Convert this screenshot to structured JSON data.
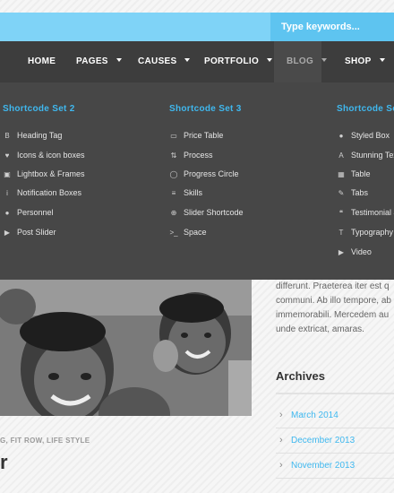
{
  "search": {
    "placeholder": "Type keywords..."
  },
  "nav": {
    "items": [
      {
        "label": "HOME"
      },
      {
        "label": "PAGES"
      },
      {
        "label": "CAUSES"
      },
      {
        "label": "PORTFOLIO"
      },
      {
        "label": "BLOG"
      },
      {
        "label": "SHOP"
      }
    ]
  },
  "mega": {
    "columns": [
      {
        "title": "Shortcode Set 2",
        "items": [
          {
            "label": "Heading Tag",
            "icon": "bold-icon"
          },
          {
            "label": "Icons & icon boxes",
            "icon": "heart-icon"
          },
          {
            "label": "Lightbox & Frames",
            "icon": "image-icon"
          },
          {
            "label": "Notification Boxes",
            "icon": "info-icon"
          },
          {
            "label": "Personnel",
            "icon": "user-icon"
          },
          {
            "label": "Post Slider",
            "icon": "play-icon"
          }
        ]
      },
      {
        "title": "Shortcode Set 3",
        "items": [
          {
            "label": "Price Table",
            "icon": "money-icon"
          },
          {
            "label": "Process",
            "icon": "sort-icon"
          },
          {
            "label": "Progress Circle",
            "icon": "circle-icon"
          },
          {
            "label": "Skills",
            "icon": "list-icon"
          },
          {
            "label": "Slider Shortcode",
            "icon": "plus-circle-icon"
          },
          {
            "label": "Space",
            "icon": "terminal-icon"
          }
        ]
      },
      {
        "title": "Shortcode Se",
        "items": [
          {
            "label": "Styled Box",
            "icon": "drop-icon"
          },
          {
            "label": "Stunning Tex",
            "icon": "font-icon"
          },
          {
            "label": "Table",
            "icon": "table-icon"
          },
          {
            "label": "Tabs",
            "icon": "edit-icon"
          },
          {
            "label": "Testimonial &",
            "icon": "quote-icon"
          },
          {
            "label": "Typography",
            "icon": "text-height-icon"
          },
          {
            "label": "Video",
            "icon": "play-circle-icon"
          }
        ]
      }
    ]
  },
  "sidebar": {
    "text_lines": [
      "differunt. Praeterea iter est q",
      "communi. Ab illo tempore, ab",
      "immemorabili. Mercedem au",
      "unde extricat, amaras."
    ],
    "archives": {
      "title": "Archives",
      "items": [
        {
          "label": "March 2014"
        },
        {
          "label": "December 2013"
        },
        {
          "label": "November 2013"
        }
      ]
    }
  },
  "post": {
    "tags": "G, FIT ROW, LIFE STYLE",
    "title_fragment": "r"
  },
  "colors": {
    "accent": "#3fb8ef",
    "topbar": "#7fd3f7",
    "nav_bg": "#3d3d3d",
    "dropdown_bg": "#474747"
  }
}
